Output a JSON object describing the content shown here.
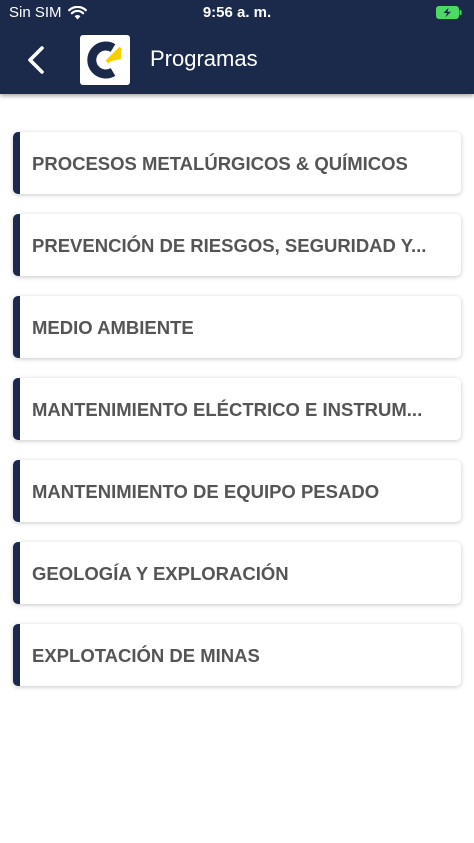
{
  "status_bar": {
    "carrier": "Sin SIM",
    "time": "9:56 a. m.",
    "icons": [
      "wifi-icon",
      "battery-charging-icon"
    ]
  },
  "header": {
    "title": "Programas",
    "back_icon": "chevron-left-icon",
    "logo_icon": "c-arrow-logo"
  },
  "colors": {
    "header_bg": "#1b2a4a",
    "accent": "#1b2a4a",
    "battery": "#4cd964",
    "logo_arrow": "#f5d000",
    "item_text": "#555555"
  },
  "programs": [
    {
      "label": "PROCESOS METALÚRGICOS & QUÍMICOS"
    },
    {
      "label": "PREVENCIÓN DE RIESGOS, SEGURIDAD Y..."
    },
    {
      "label": "MEDIO AMBIENTE"
    },
    {
      "label": "MANTENIMIENTO ELÉCTRICO E INSTRUM..."
    },
    {
      "label": "MANTENIMIENTO DE EQUIPO PESADO"
    },
    {
      "label": "GEOLOGÍA Y EXPLORACIÓN"
    },
    {
      "label": "EXPLOTACIÓN DE MINAS"
    }
  ]
}
